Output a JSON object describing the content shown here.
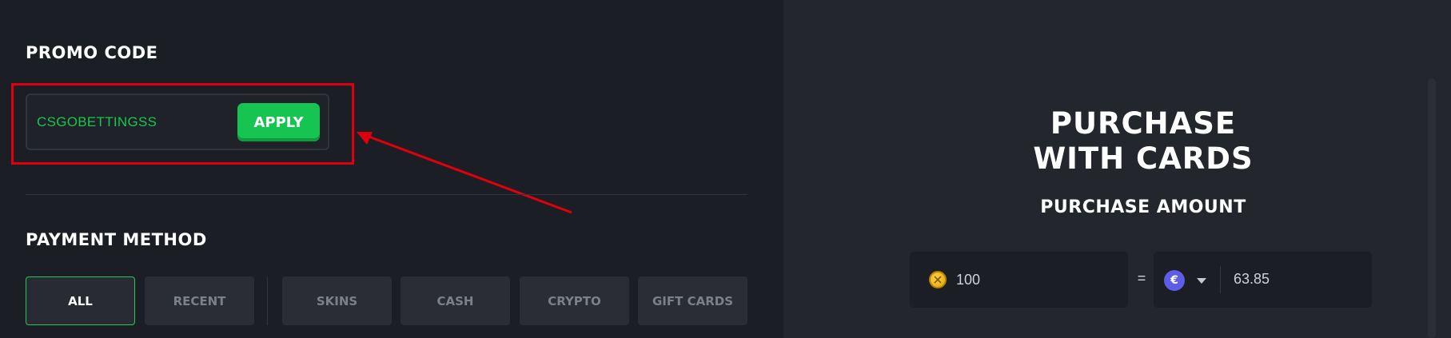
{
  "promo": {
    "title": "PROMO CODE",
    "code_value": "CSGOBETTINGSS",
    "apply_label": "APPLY"
  },
  "payment": {
    "title": "PAYMENT METHOD",
    "tabs": [
      {
        "label": "ALL",
        "active": true
      },
      {
        "label": "RECENT",
        "active": false
      },
      {
        "label": "SKINS",
        "active": false
      },
      {
        "label": "CASH",
        "active": false
      },
      {
        "label": "CRYPTO",
        "active": false
      },
      {
        "label": "GIFT CARDS",
        "active": false
      }
    ]
  },
  "purchase": {
    "heading_line1": "PURCHASE",
    "heading_line2": "WITH CARDS",
    "amount_label": "PURCHASE AMOUNT",
    "coin_amount": "100",
    "equals": "=",
    "currency_symbol": "€",
    "currency_amount": "63.85",
    "coin_icon": "coin-icon",
    "currency_icon": "euro-icon"
  },
  "colors": {
    "accent_green": "#16c451",
    "annotation_red": "#e0000d",
    "currency_purple": "#5d5de8"
  }
}
